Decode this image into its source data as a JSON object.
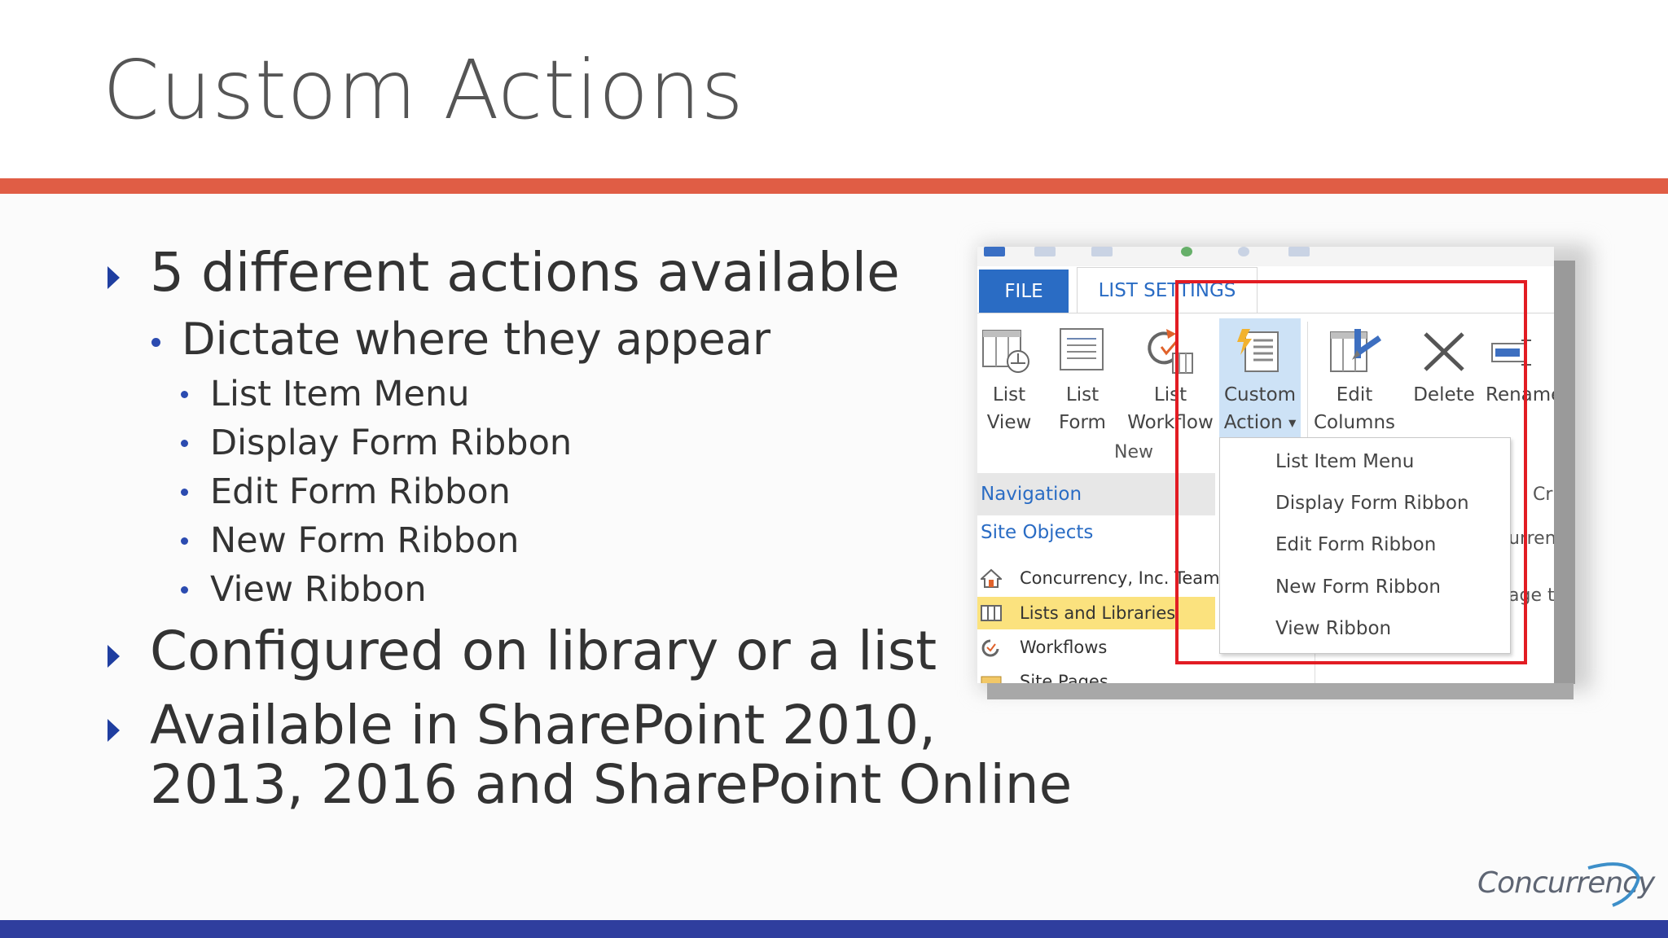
{
  "slide": {
    "title": "Custom Actions",
    "colors": {
      "accent_bar": "#e05d45",
      "footer_bar": "#2f3e9e",
      "bullet": "#1f3ea0"
    },
    "bullets": [
      {
        "text": "5 different actions available",
        "sub": [
          {
            "text": "Dictate where they appear",
            "items": [
              "List Item Menu",
              "Display Form Ribbon",
              "Edit Form Ribbon",
              "New Form Ribbon",
              "View Ribbon"
            ]
          }
        ]
      },
      {
        "text": "Configured on library or a list"
      },
      {
        "text": "Available in SharePoint 2010,",
        "text2": "2013, 2016 and SharePoint Online"
      }
    ]
  },
  "screenshot": {
    "tabs": {
      "file": "FILE",
      "list_settings": "LIST SETTINGS"
    },
    "ribbon": {
      "buttons": [
        {
          "line1": "List",
          "line2": "View",
          "icon": "list-view-icon"
        },
        {
          "line1": "List",
          "line2": "Form",
          "icon": "list-form-icon"
        },
        {
          "line1": "List",
          "line2": "Workflow",
          "icon": "list-workflow-icon"
        },
        {
          "line1": "Custom",
          "line2": "Action",
          "icon": "custom-action-icon"
        },
        {
          "line1": "Edit",
          "line2": "Columns",
          "icon": "edit-columns-icon"
        },
        {
          "line1": "Delete",
          "line2": "",
          "icon": "delete-icon"
        },
        {
          "line1": "Rename",
          "line2": "",
          "icon": "rename-icon"
        }
      ],
      "group_label": "New"
    },
    "dropdown": {
      "items": [
        "List Item Menu",
        "Display Form Ribbon",
        "Edit Form Ribbon",
        "New Form Ribbon",
        "View Ribbon"
      ]
    },
    "nav": {
      "header": "Navigation",
      "site_objects": "Site Objects",
      "items": [
        {
          "label": "Concurrency, Inc. Team",
          "icon": "home-icon"
        },
        {
          "label": "Lists and Libraries",
          "icon": "list-icon",
          "selected": true
        },
        {
          "label": "Workflows",
          "icon": "workflow-icon"
        },
        {
          "label": "Site Pages",
          "icon": "folder-icon"
        }
      ]
    },
    "right_fragments": [
      "Cr",
      "urren",
      "age t"
    ]
  },
  "logo": {
    "text": "Concurrency"
  }
}
